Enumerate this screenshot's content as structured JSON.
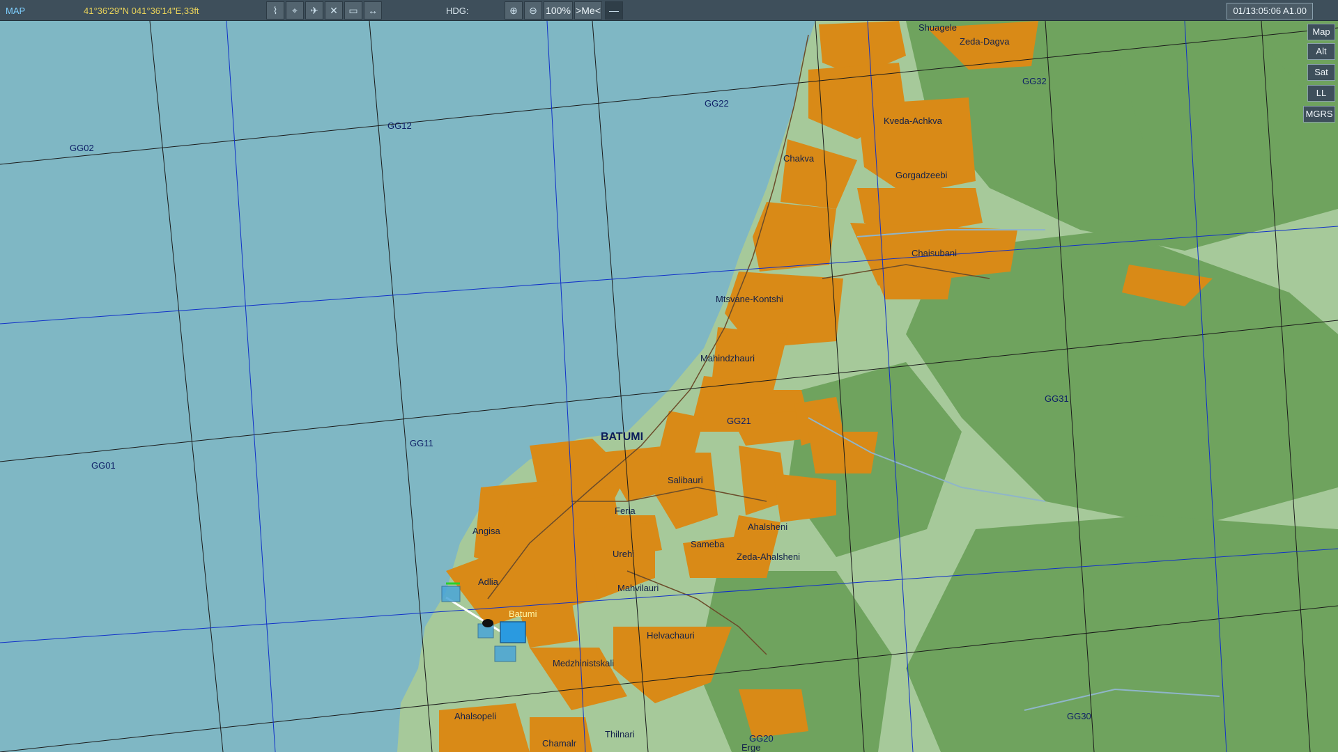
{
  "toolbar": {
    "title": "MAP",
    "coords": "41°36'29\"N 041°36'14\"E,33ft",
    "hdg_label": "HDG:",
    "zoom": "100%",
    "me_label": ">Me<",
    "time": "01/13:05:06 A1.00"
  },
  "side_buttons": [
    "Map",
    "Alt",
    "Sat",
    "LL",
    "MGRS"
  ],
  "grid_labels": [
    "GG02",
    "GG12",
    "GG22",
    "GG32",
    "GG01",
    "GG11",
    "GG21",
    "GG31",
    "GG20",
    "GG30"
  ],
  "places": {
    "batumi_city": "BATUMI",
    "shuagele": "Shuagele",
    "zeda_dagva": "Zeda-Dagva",
    "kveda_achkva": "Kveda-Achkva",
    "chakva": "Chakva",
    "gorgadzeebi": "Gorgadzeebi",
    "chaisubani": "Chaisubani",
    "mtsvane_kontshi": "Mtsvane-Kontshi",
    "mahindzhauri": "Mahindzhauri",
    "salibauri": "Salibauri",
    "feria": "Feria",
    "angisa": "Angisa",
    "sameba": "Sameba",
    "ahalsheni": "Ahalsheni",
    "zeda_ahalsheni": "Zeda-Ahalsheni",
    "urehi": "Urehi",
    "adlia": "Adlia",
    "mahvilauri": "Mahvilauri",
    "helvachauri": "Helvachauri",
    "medzhinistskali": "Medzhinistskali",
    "ahalsopeli": "Ahalsopeli",
    "thilnari": "Thilnari",
    "chamalr": "Chamalr",
    "erge": "Erge"
  },
  "airfield": "Batumi",
  "colors": {
    "sea": "#7fb7c4",
    "land": "#a6c99a",
    "forest": "#6fa35e",
    "urban": "#d98a17",
    "grid_black": "#1a1a1a",
    "grid_blue": "#1030c8"
  }
}
